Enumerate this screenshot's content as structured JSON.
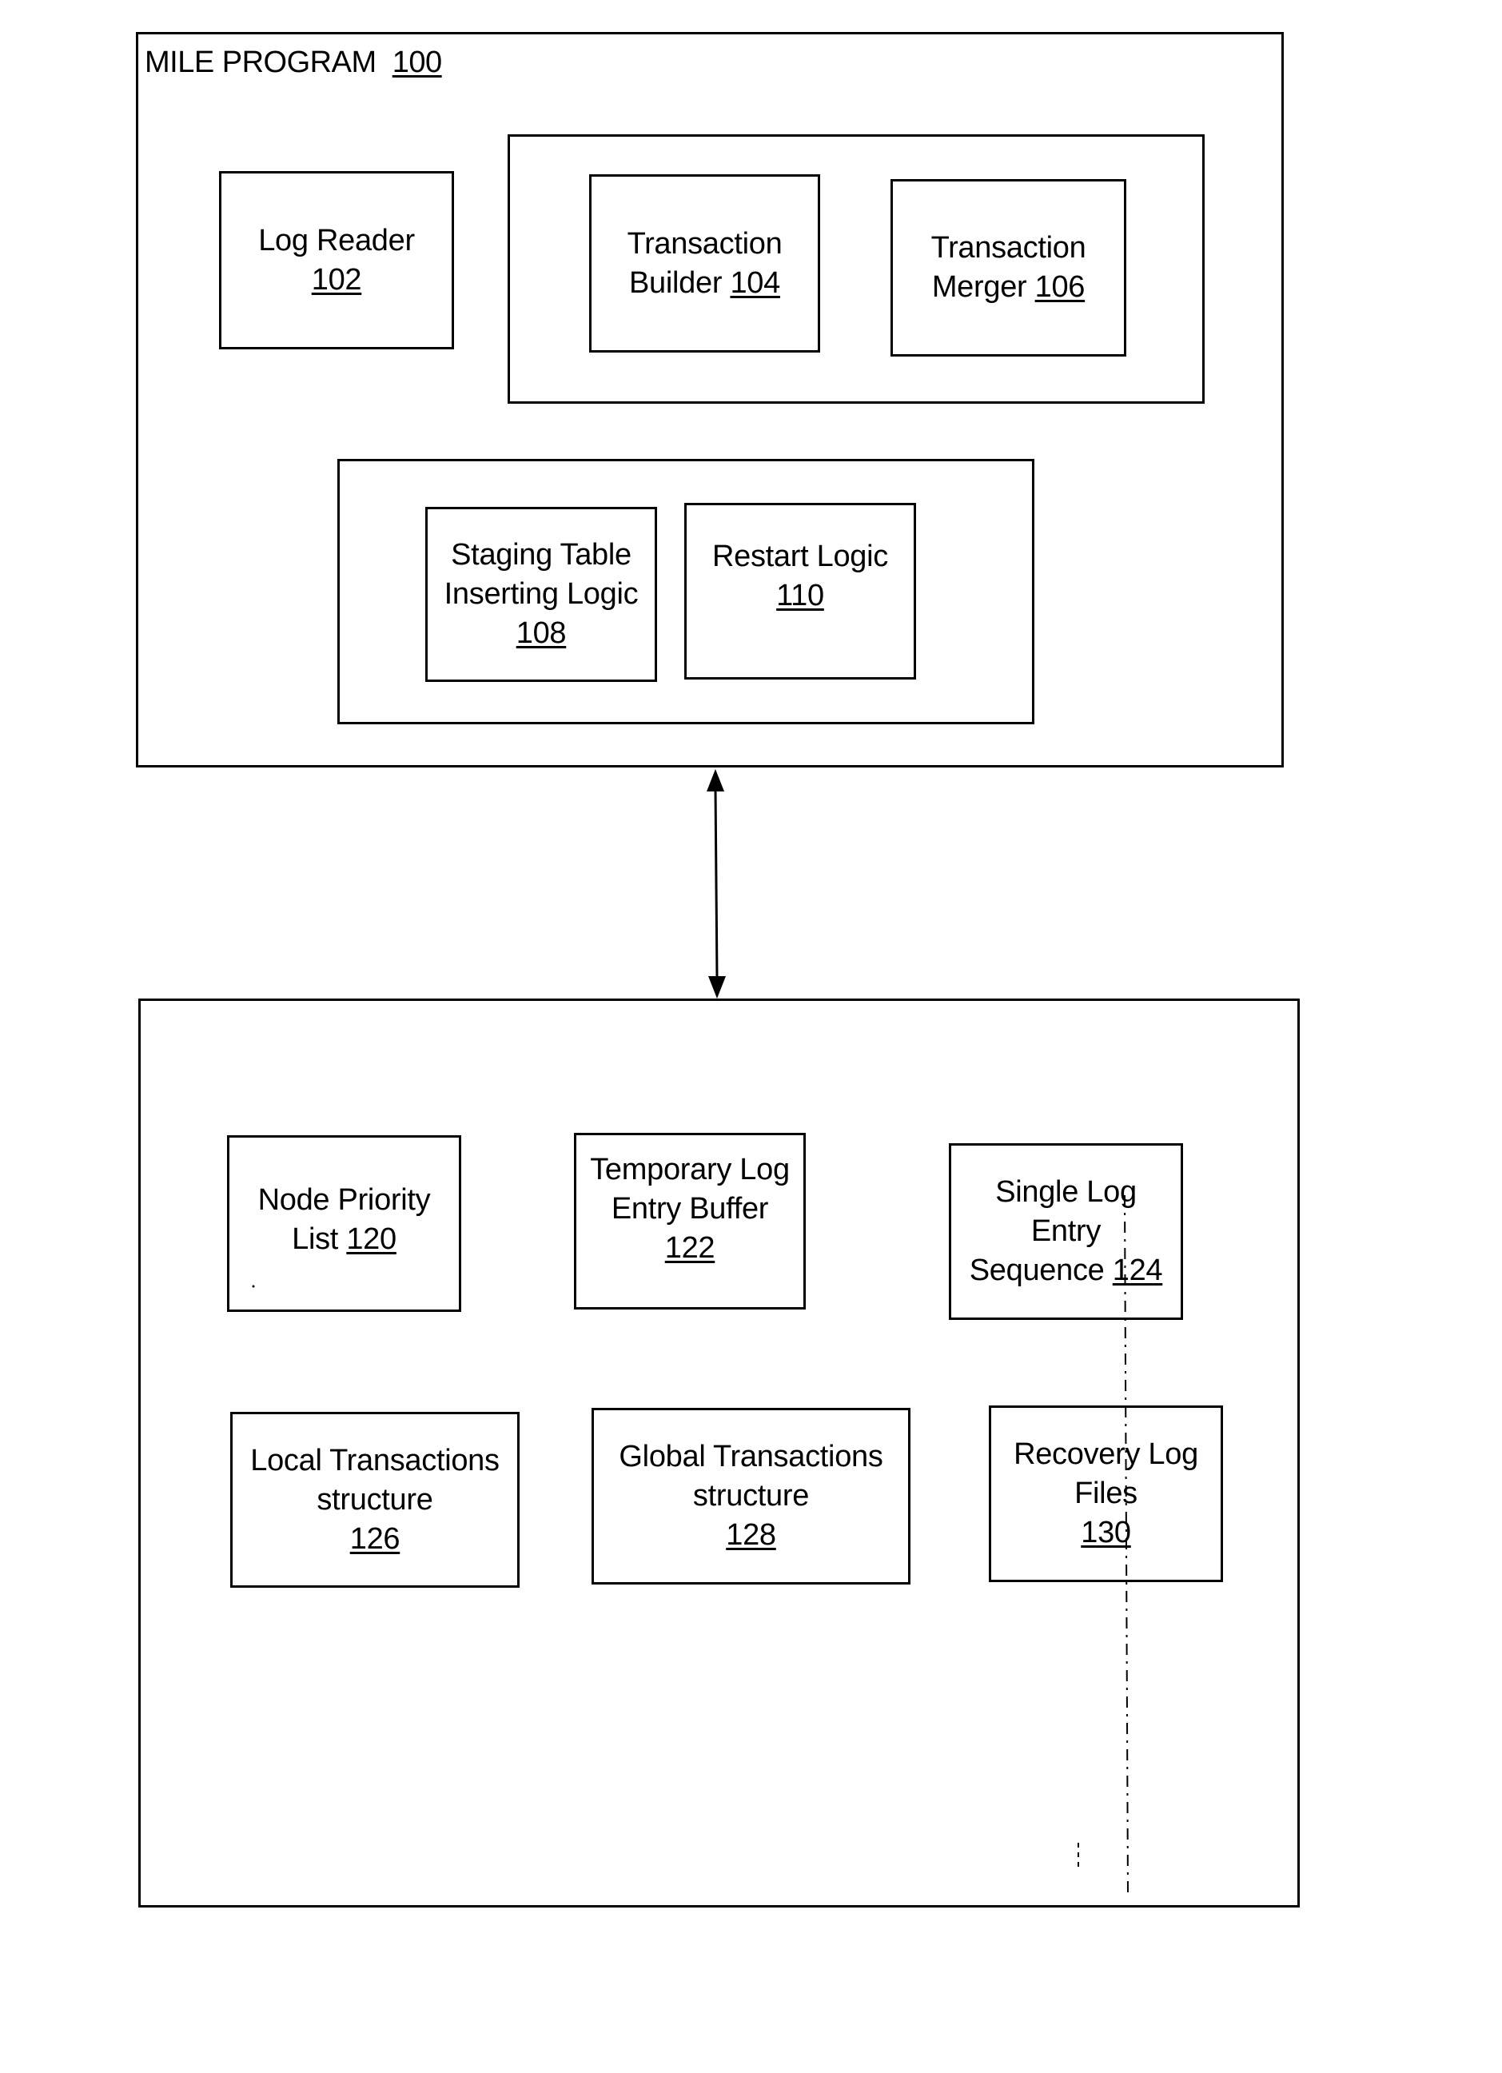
{
  "diagram": {
    "top_container": {
      "title": "MILE PROGRAM",
      "ref": "100"
    },
    "components_top": [
      {
        "id": "log-reader",
        "label": "Log Reader\n",
        "ref": "102"
      },
      {
        "id": "transaction-builder",
        "label": "Transaction\nBuilder ",
        "ref": "104"
      },
      {
        "id": "transaction-merger",
        "label": "Transaction\nMerger ",
        "ref": "106"
      },
      {
        "id": "staging-table-inserting-logic",
        "label": "Staging Table\nInserting Logic\n",
        "ref": "108"
      },
      {
        "id": "restart-logic",
        "label": "Restart Logic\n",
        "ref": "110"
      }
    ],
    "components_bottom": [
      {
        "id": "node-priority-list",
        "label": "Node Priority\nList ",
        "ref": "120"
      },
      {
        "id": "temporary-log-entry-buffer",
        "label": "Temporary Log\nEntry Buffer\n",
        "ref": "122"
      },
      {
        "id": "single-log-entry-sequence",
        "label": "Single Log\nEntry\nSequence ",
        "ref": "124"
      },
      {
        "id": "local-transactions-structure",
        "label": "Local Transactions\nstructure\n",
        "ref": "126"
      },
      {
        "id": "global-transactions-structure",
        "label": "Global Transactions\nstructure\n",
        "ref": "128"
      },
      {
        "id": "recovery-log-files",
        "label": "Recovery Log\nFiles\n",
        "ref": "130"
      }
    ],
    "connector": {
      "type": "bidirectional-arrow",
      "from": "top_container",
      "to": "bottom_container"
    }
  }
}
